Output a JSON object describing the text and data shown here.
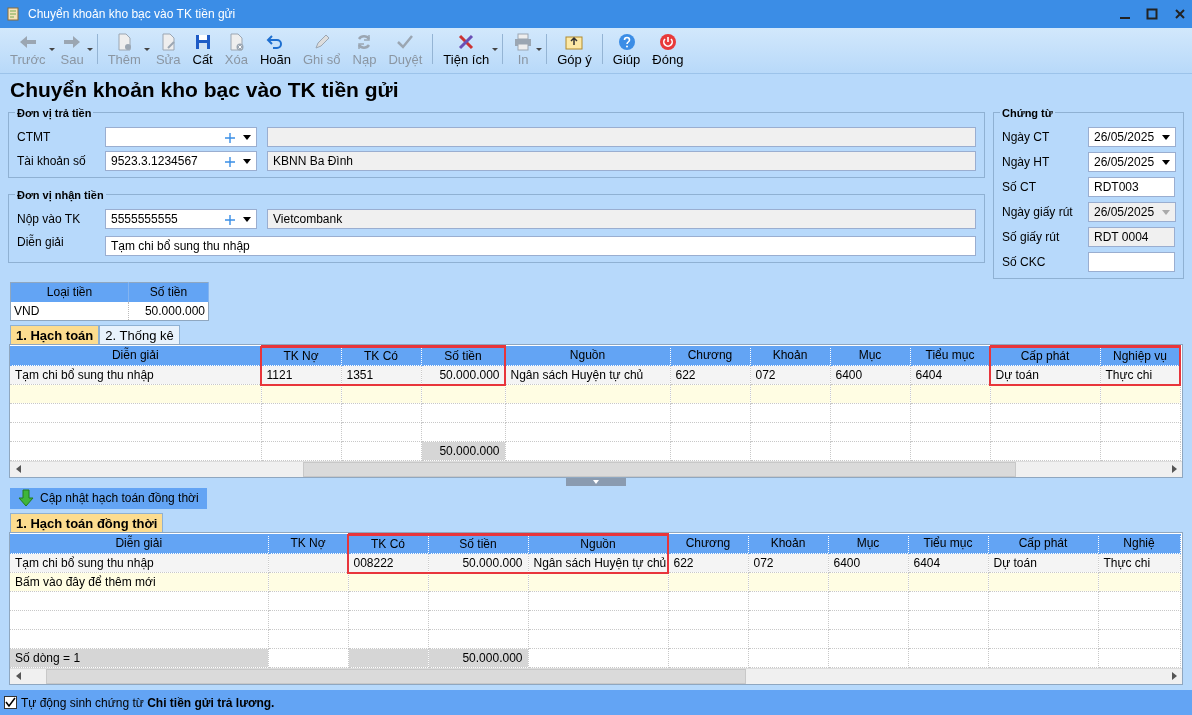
{
  "window": {
    "title": "Chuyển khoản kho bạc vào TK tiền gửi"
  },
  "toolbar": [
    [
      {
        "label": "Trước",
        "disabled": true,
        "dropdown": true
      },
      {
        "label": "Sau",
        "disabled": true,
        "dropdown": true
      }
    ],
    [
      {
        "label": "Thêm",
        "disabled": true,
        "dropdown": true
      },
      {
        "label": "Sửa",
        "disabled": true,
        "dropdown": false
      },
      {
        "label": "Cất",
        "disabled": false,
        "dropdown": false
      },
      {
        "label": "Xóa",
        "disabled": true,
        "dropdown": false
      },
      {
        "label": "Hoãn",
        "disabled": false,
        "dropdown": false
      },
      {
        "label": "Ghi sổ",
        "disabled": true,
        "dropdown": false
      },
      {
        "label": "Nạp",
        "disabled": true,
        "dropdown": false
      },
      {
        "label": "Duyệt",
        "disabled": true,
        "dropdown": false
      }
    ],
    [
      {
        "label": "Tiện ích",
        "disabled": false,
        "dropdown": true
      }
    ],
    [
      {
        "label": "In",
        "disabled": true,
        "dropdown": true
      }
    ],
    [
      {
        "label": "Góp ý",
        "disabled": false,
        "dropdown": false
      }
    ],
    [
      {
        "label": "Giúp",
        "disabled": false,
        "dropdown": false
      },
      {
        "label": "Đóng",
        "disabled": false,
        "dropdown": false
      }
    ]
  ],
  "heading": "Chuyển khoản kho bạc vào TK tiền gửi",
  "groups": [
    {
      "title": "Đơn vị trả tiền",
      "rows": [
        {
          "kind": "combo",
          "label": "CTMT"
        },
        {
          "kind": "combo",
          "label": "Tài khoản số",
          "value": "9523.3.1234567",
          "name": "KBNN Ba Đình"
        }
      ]
    },
    {
      "title": "Đơn vị nhận tiền",
      "rows": [
        {
          "kind": "combo",
          "label": "Nộp vào TK",
          "value": "5555555555",
          "name": "Vietcombank"
        },
        {
          "kind": "text",
          "label": "Diễn giải",
          "value": "Tạm chi bổ sung thu nhập"
        }
      ]
    }
  ],
  "voucher": {
    "title": "Chứng từ",
    "fields": [
      {
        "kind": "date",
        "label": "Ngày CT",
        "value": "26/05/2025",
        "disabled": false
      },
      {
        "kind": "date",
        "label": "Ngày HT",
        "value": "26/05/2025",
        "disabled": false
      },
      {
        "kind": "text",
        "label": "Số CT",
        "value": "RDT003",
        "disabled": false
      },
      {
        "kind": "date",
        "label": "Ngày giấy rút",
        "value": "26/05/2025",
        "disabled": true
      },
      {
        "kind": "text",
        "label": "Số giấy rút",
        "value": "RDT 0004",
        "disabled": true
      },
      {
        "kind": "text",
        "label": "Số CKC",
        "disabled": false
      }
    ]
  },
  "currency": {
    "columns": [
      "Loại tiền",
      "Số tiền"
    ],
    "rows": [
      [
        "VND",
        "50.000.000"
      ]
    ]
  },
  "grids": [
    {
      "tabs": [
        {
          "label": "1. Hạch toán",
          "selected": true
        },
        {
          "label": "2. Thống kê",
          "selected": false
        }
      ],
      "columns": [
        {
          "label": "Diễn giải",
          "kind": "text",
          "highlighted": false
        },
        {
          "label": "TK Nợ",
          "kind": "text",
          "highlighted": true
        },
        {
          "label": "TK Có",
          "kind": "text",
          "highlighted": true
        },
        {
          "label": "Số tiền",
          "kind": "amount",
          "highlighted": true
        },
        {
          "label": "Nguồn",
          "kind": "text",
          "highlighted": false
        },
        {
          "label": "Chương",
          "kind": "text",
          "highlighted": false
        },
        {
          "label": "Khoản",
          "kind": "text",
          "highlighted": false
        },
        {
          "label": "Mục",
          "kind": "text",
          "highlighted": false
        },
        {
          "label": "Tiểu mục",
          "kind": "text",
          "highlighted": false
        },
        {
          "label": "Cấp phát",
          "kind": "text",
          "highlighted": true
        },
        {
          "label": "Nghiệp vụ",
          "kind": "text",
          "highlighted": true
        }
      ],
      "rows": [
        [
          "Tạm chi bổ sung thu nhập",
          "1121",
          "1351",
          "50.000.000",
          "Ngân sách Huyện tự chủ",
          "622",
          "072",
          "6400",
          "6404",
          "Dự toán",
          "Thực chi"
        ]
      ],
      "footer": {
        "total": "50.000.000"
      }
    },
    {
      "button": "Cập nhật hạch toán đồng thời",
      "tabs": [
        {
          "label": "1. Hạch toán đồng thời",
          "selected": true
        }
      ],
      "columns": [
        {
          "label": "Diễn giải",
          "kind": "text",
          "highlighted": false
        },
        {
          "label": "TK Nợ",
          "kind": "text",
          "highlighted": false
        },
        {
          "label": "TK Có",
          "kind": "text",
          "highlighted": true
        },
        {
          "label": "Số tiền",
          "kind": "amount",
          "highlighted": true
        },
        {
          "label": "Nguồn",
          "kind": "text",
          "highlighted": true
        },
        {
          "label": "Chương",
          "kind": "text",
          "highlighted": false
        },
        {
          "label": "Khoản",
          "kind": "text",
          "highlighted": false
        },
        {
          "label": "Mục",
          "kind": "text",
          "highlighted": false
        },
        {
          "label": "Tiểu mục",
          "kind": "text",
          "highlighted": false
        },
        {
          "label": "Cấp phát",
          "kind": "text",
          "highlighted": false
        },
        {
          "label": "Nghiệ",
          "kind": "text",
          "highlighted": false
        }
      ],
      "rows": [
        [
          "Tạm chi bổ sung thu nhập",
          "",
          "008222",
          "50.000.000",
          "Ngân sách Huyện tự chủ",
          "622",
          "072",
          "6400",
          "6404",
          "Dự toán",
          "Thực chi"
        ]
      ],
      "new_row_placeholder": "Bấm vào đây để thêm mới",
      "footer": {
        "row_count": "Số dòng = 1",
        "total": "50.000.000"
      }
    }
  ],
  "auto_generate": {
    "checked": true,
    "text": "Tự động sinh chứng từ **Chi tiền gửi trả lương.**"
  }
}
